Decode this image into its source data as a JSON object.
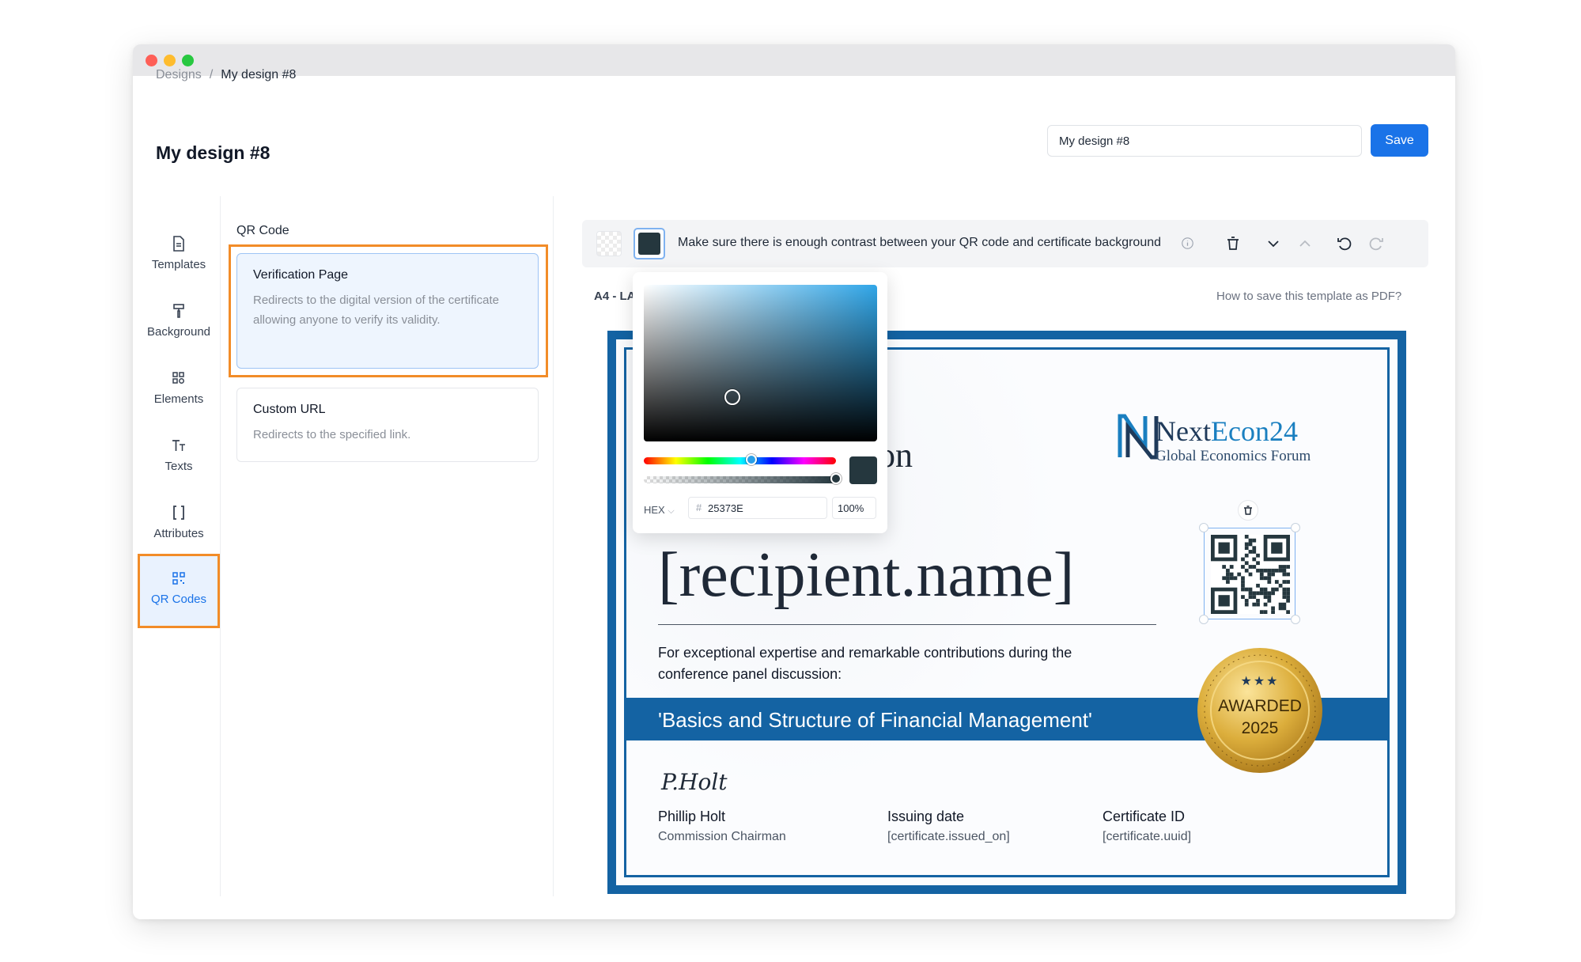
{
  "breadcrumb": {
    "root": "Designs",
    "separator": "/",
    "current": "My design #8"
  },
  "header": {
    "title": "My design #8",
    "name_value": "My design #8",
    "save_label": "Save"
  },
  "rail": {
    "items": [
      {
        "label": "Templates",
        "icon": "file-icon"
      },
      {
        "label": "Background",
        "icon": "paint-roller-icon"
      },
      {
        "label": "Elements",
        "icon": "shapes-icon"
      },
      {
        "label": "Texts",
        "icon": "text-icon"
      },
      {
        "label": "Attributes",
        "icon": "brackets-icon"
      },
      {
        "label": "QR Codes",
        "icon": "qr-icon"
      }
    ],
    "active_index": 5
  },
  "panel": {
    "title": "QR Code",
    "options": [
      {
        "title": "Verification Page",
        "description": "Redirects to the digital version of the certificate allowing anyone to verify its validity.",
        "selected": true
      },
      {
        "title": "Custom URL",
        "description": "Redirects to the specified link.",
        "selected": false
      }
    ]
  },
  "toolbar": {
    "message": "Make sure there is enough contrast between your QR code and certificate background",
    "icons": [
      "info-icon",
      "trash-icon",
      "chevron-down-icon",
      "chevron-up-icon",
      "undo-icon",
      "redo-icon"
    ]
  },
  "canvas": {
    "format_label": "A4 - LA",
    "pdf_help": "How to save this template as PDF?"
  },
  "color_picker": {
    "mode": "HEX",
    "hash": "#",
    "hex": "25373E",
    "alpha": "100%",
    "color": "#25373e",
    "hue_fraction": 0.56,
    "alpha_fraction": 1.0
  },
  "certificate": {
    "brand_name_a": "Next",
    "brand_name_b": "Econ24",
    "brand_sub": "Global Economics Forum",
    "title_fragment": "on",
    "recipient": "[recipient.name]",
    "description": "For exceptional expertise and remarkable contributions during the conference panel discussion:",
    "topic": "'Basics and Structure of Financial Management'",
    "signature": "P.Holt",
    "signer_name": "Phillip Holt",
    "signer_role": "Commission Chairman",
    "issuing_label": "Issuing date",
    "issuing_value": "[certificate.issued_on]",
    "cert_id_label": "Certificate ID",
    "cert_id_value": "[certificate.uuid]",
    "medal_top": "★★★",
    "medal_line1": "AWARDED",
    "medal_line2": "2025"
  },
  "colors": {
    "accent": "#1a73e8",
    "highlight": "#f28c28",
    "cert_blue": "#1463a3",
    "gold": "#d4a62a"
  }
}
